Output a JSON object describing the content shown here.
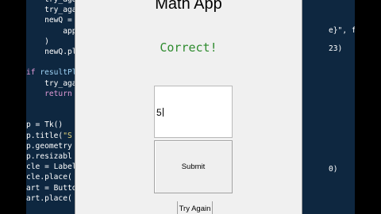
{
  "app": {
    "title": "Math App",
    "result_text": "Correct!",
    "answer_value": "5",
    "submit_label": "Submit",
    "try_again_label": "Try Again",
    "result_color": "#2e8b2e"
  },
  "editor": {
    "background": "#0e2740",
    "right_fragments": [
      "e}\", font=(",
      "23)",
      "0)"
    ]
  }
}
